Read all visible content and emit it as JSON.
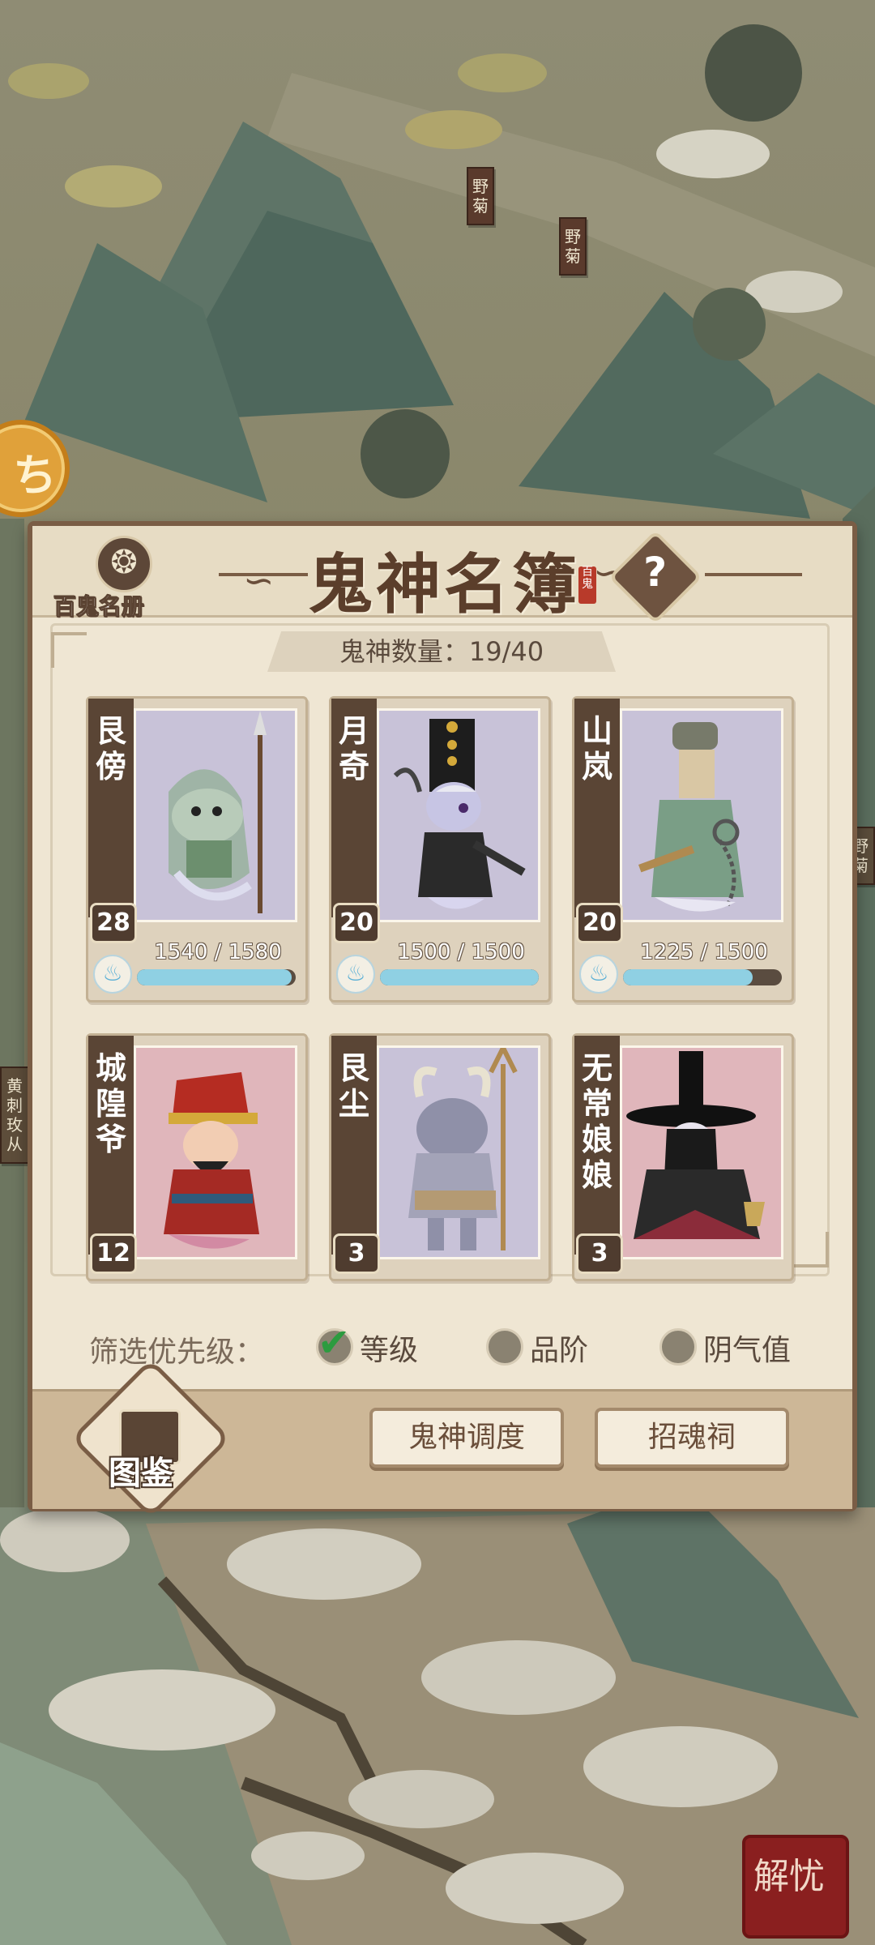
{
  "map": {
    "signs": [
      "野菊",
      "野菊",
      "野菊",
      "黄刺玫从"
    ]
  },
  "panel": {
    "title": "鬼神名簿",
    "title_stamp": "百鬼",
    "help_icon": "?",
    "roster_button_label": "百鬼名册",
    "count_text": "鬼神数量：19/40"
  },
  "cards": [
    {
      "name": "艮傍",
      "level": "28",
      "hp_text": "1540 / 1580",
      "hp_fraction": 0.975,
      "art": "green-ghost-spear"
    },
    {
      "name": "月奇",
      "level": "20",
      "hp_text": "1500 / 1500",
      "hp_fraction": 1.0,
      "art": "black-hat-ghost"
    },
    {
      "name": "山岚",
      "level": "20",
      "hp_text": "1225 / 1500",
      "hp_fraction": 0.817,
      "art": "masked-ghost-chain"
    },
    {
      "name": "城隍爷",
      "level": "12",
      "art": "red-official"
    },
    {
      "name": "艮尘",
      "level": "3",
      "art": "ox-demon-trident"
    },
    {
      "name": "无常娘娘",
      "level": "3",
      "art": "black-hat-lady"
    }
  ],
  "filter": {
    "label": "筛选优先级：",
    "options": [
      {
        "label": "等级",
        "checked": true
      },
      {
        "label": "品阶",
        "checked": false
      },
      {
        "label": "阴气值",
        "checked": false
      }
    ]
  },
  "footer": {
    "atlas_label": "图鉴",
    "dispatch_button": "鬼神调度",
    "shrine_button": "招魂祠"
  },
  "corner_seal": "解忧",
  "colors": {
    "panel_bg": "#efe6d3",
    "panel_border": "#7a5d45",
    "hp_fill": "#8fd0e3",
    "check_green": "#2c9b3f"
  }
}
